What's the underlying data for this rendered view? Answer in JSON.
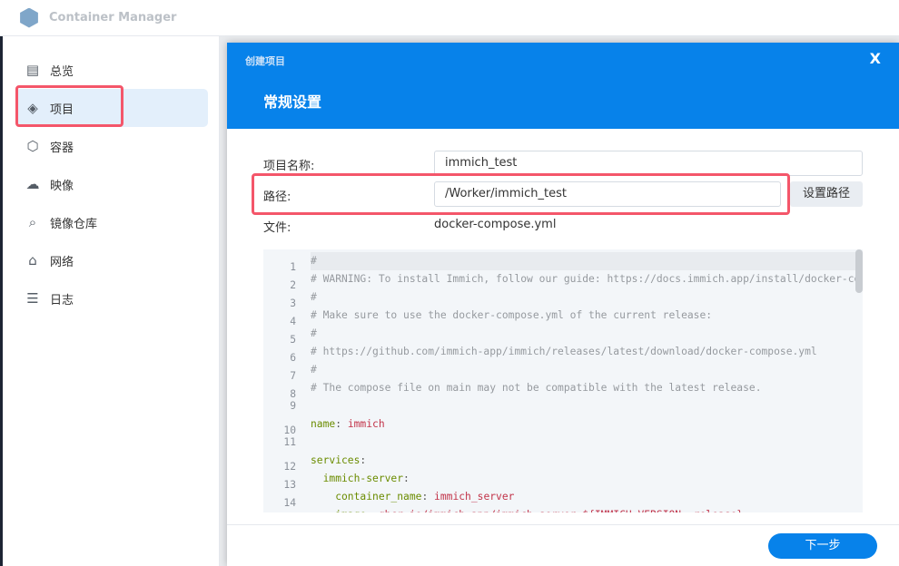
{
  "app": {
    "title": "Container Manager"
  },
  "sidebar": {
    "items": [
      {
        "label": "总览",
        "icon": "overview-icon",
        "glyph": "▤"
      },
      {
        "label": "项目",
        "icon": "layers-icon",
        "glyph": "◈"
      },
      {
        "label": "容器",
        "icon": "cube-icon",
        "glyph": "⬡"
      },
      {
        "label": "映像",
        "icon": "cloud-icon",
        "glyph": "☁"
      },
      {
        "label": "镜像仓库",
        "icon": "registry-search-icon",
        "glyph": "⌕"
      },
      {
        "label": "网络",
        "icon": "network-icon",
        "glyph": "⌂"
      },
      {
        "label": "日志",
        "icon": "list-icon",
        "glyph": "☰"
      }
    ],
    "active": 1
  },
  "dialog": {
    "title": "创建项目",
    "close": "X",
    "subtitle": "常规设置",
    "name_label": "项目名称:",
    "name_value": "immich_test",
    "path_label": "路径:",
    "path_value": "/Worker/immich_test",
    "set_path": "设置路径",
    "file_label": "文件:",
    "file_value": "docker-compose.yml",
    "next": "下一步"
  },
  "editor": {
    "lines": [
      [
        {
          "t": "#",
          "c": "comment"
        }
      ],
      [
        {
          "t": "# WARNING: To install Immich, follow our guide: https://docs.immich.app/install/docker-compose",
          "c": "comment"
        }
      ],
      [
        {
          "t": "#",
          "c": "comment"
        }
      ],
      [
        {
          "t": "# Make sure to use the docker-compose.yml of the current release:",
          "c": "comment"
        }
      ],
      [
        {
          "t": "#",
          "c": "comment"
        }
      ],
      [
        {
          "t": "# https://github.com/immich-app/immich/releases/latest/download/docker-compose.yml",
          "c": "comment"
        }
      ],
      [
        {
          "t": "#",
          "c": "comment"
        }
      ],
      [
        {
          "t": "# The compose file on main may not be compatible with the latest release.",
          "c": "comment"
        }
      ],
      [],
      [
        {
          "t": "name",
          "c": "key"
        },
        {
          "t": ": ",
          "c": "punct"
        },
        {
          "t": "immich",
          "c": "val"
        }
      ],
      [],
      [
        {
          "t": "services",
          "c": "key"
        },
        {
          "t": ":",
          "c": "punct"
        }
      ],
      [
        {
          "t": "  immich-server",
          "c": "key"
        },
        {
          "t": ":",
          "c": "punct"
        }
      ],
      [
        {
          "t": "    container_name",
          "c": "key"
        },
        {
          "t": ": ",
          "c": "punct"
        },
        {
          "t": "immich_server",
          "c": "val"
        }
      ],
      [
        {
          "t": "    image",
          "c": "key"
        },
        {
          "t": ": ",
          "c": "punct"
        },
        {
          "t": "ghcr.io/immich-app/immich-server:${IMMICH_VERSION:-release}",
          "c": "val"
        }
      ]
    ]
  },
  "colors": {
    "accent": "#0782ea",
    "highlight": "#f4566a"
  }
}
